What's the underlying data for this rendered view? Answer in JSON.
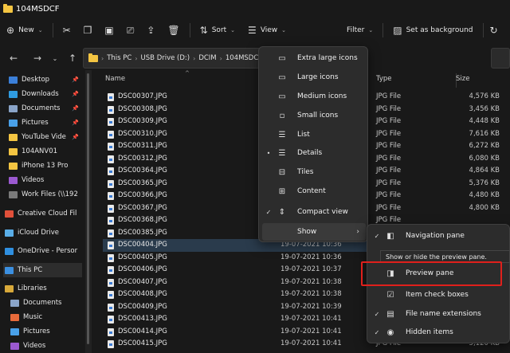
{
  "window": {
    "title": "104MSDCF"
  },
  "toolbar": {
    "new_label": "New",
    "sort_label": "Sort",
    "view_label": "View",
    "filter_label": "Filter",
    "background_label": "Set as background"
  },
  "address": {
    "crumbs": [
      "This PC",
      "USB Drive (D:)",
      "DCIM",
      "104MSDC"
    ]
  },
  "sidebar": {
    "items": [
      {
        "label": "Desktop",
        "color": "#3b7fd8",
        "pinned": true
      },
      {
        "label": "Downloads",
        "color": "#2f9be0",
        "pinned": true
      },
      {
        "label": "Documents",
        "color": "#8aa4c8",
        "pinned": true
      },
      {
        "label": "Pictures",
        "color": "#49a0e8",
        "pinned": true
      },
      {
        "label": "YouTube Vide",
        "color": "#f4c542",
        "pinned": true
      },
      {
        "label": "104ANV01",
        "color": "#f4c542",
        "pinned": false
      },
      {
        "label": "iPhone 13 Pro",
        "color": "#f4c542",
        "pinned": false
      },
      {
        "label": "Videos",
        "color": "#9b59d0",
        "pinned": false
      },
      {
        "label": "Work Files (\\\\192",
        "color": "#7a7a7a",
        "pinned": false
      },
      {
        "label": "Creative Cloud Fil",
        "color": "#e0503a",
        "pinned": false
      },
      {
        "label": "iCloud Drive",
        "color": "#5aaee8",
        "pinned": false
      },
      {
        "label": "OneDrive - Persor",
        "color": "#2f8fe0",
        "pinned": false
      },
      {
        "label": "This PC",
        "color": "#3b8fe0",
        "pinned": false
      },
      {
        "label": "Libraries",
        "color": "#d8a93a",
        "pinned": false
      },
      {
        "label": "Documents",
        "color": "#8aa4c8",
        "pinned": false
      },
      {
        "label": "Music",
        "color": "#e86a3a",
        "pinned": false
      },
      {
        "label": "Pictures",
        "color": "#49a0e8",
        "pinned": false
      },
      {
        "label": "Videos",
        "color": "#9b59d0",
        "pinned": false
      }
    ]
  },
  "columns": {
    "name": "Name",
    "type": "Type",
    "size": "Size"
  },
  "files": [
    {
      "name": "DSC00307.JPG",
      "date": "",
      "type": "JPG File",
      "size": "4,576 KB"
    },
    {
      "name": "DSC00308.JPG",
      "date": "",
      "type": "JPG File",
      "size": "3,456 KB"
    },
    {
      "name": "DSC00309.JPG",
      "date": "",
      "type": "JPG File",
      "size": "4,448 KB"
    },
    {
      "name": "DSC00310.JPG",
      "date": "",
      "type": "JPG File",
      "size": "7,616 KB"
    },
    {
      "name": "DSC00311.JPG",
      "date": "",
      "type": "JPG File",
      "size": "6,272 KB"
    },
    {
      "name": "DSC00312.JPG",
      "date": "",
      "type": "JPG File",
      "size": "6,080 KB"
    },
    {
      "name": "DSC00364.JPG",
      "date": "",
      "type": "JPG File",
      "size": "4,864 KB"
    },
    {
      "name": "DSC00365.JPG",
      "date": "",
      "type": "JPG File",
      "size": "5,376 KB"
    },
    {
      "name": "DSC00366.JPG",
      "date": "",
      "type": "JPG File",
      "size": "4,480 KB"
    },
    {
      "name": "DSC00367.JPG",
      "date": "",
      "type": "JPG File",
      "size": "4,800 KB"
    },
    {
      "name": "DSC00368.JPG",
      "date": "",
      "type": "JPG File",
      "size": ""
    },
    {
      "name": "DSC00385.JPG",
      "date": "",
      "type": "",
      "size": ""
    },
    {
      "name": "DSC00404.JPG",
      "date": "19-07-2021 10:36",
      "type": "",
      "size": ""
    },
    {
      "name": "DSC00405.JPG",
      "date": "19-07-2021 10:36",
      "type": "",
      "size": ""
    },
    {
      "name": "DSC00406.JPG",
      "date": "19-07-2021 10:37",
      "type": "",
      "size": ""
    },
    {
      "name": "DSC00407.JPG",
      "date": "19-07-2021 10:38",
      "type": "",
      "size": ""
    },
    {
      "name": "DSC00408.JPG",
      "date": "19-07-2021 10:38",
      "type": "",
      "size": ""
    },
    {
      "name": "DSC00409.JPG",
      "date": "19-07-2021 10:39",
      "type": "",
      "size": ""
    },
    {
      "name": "DSC00413.JPG",
      "date": "19-07-2021 10:41",
      "type": "",
      "size": ""
    },
    {
      "name": "DSC00414.JPG",
      "date": "19-07-2021 10:41",
      "type": "",
      "size": ""
    },
    {
      "name": "DSC00415.JPG",
      "date": "19-07-2021 10:41",
      "type": "JPG File",
      "size": "5,120 KB"
    }
  ],
  "view_menu": {
    "items": [
      {
        "label": "Extra large icons",
        "icon": "▭",
        "mark": ""
      },
      {
        "label": "Large icons",
        "icon": "▭",
        "mark": ""
      },
      {
        "label": "Medium icons",
        "icon": "▭",
        "mark": ""
      },
      {
        "label": "Small icons",
        "icon": "▫",
        "mark": ""
      },
      {
        "label": "List",
        "icon": "☰",
        "mark": ""
      },
      {
        "label": "Details",
        "icon": "☰",
        "mark": "•"
      },
      {
        "label": "Tiles",
        "icon": "⊟",
        "mark": ""
      },
      {
        "label": "Content",
        "icon": "⊞",
        "mark": ""
      },
      {
        "label": "Compact view",
        "icon": "⇕",
        "mark": "✓"
      },
      {
        "label": "Show",
        "icon": "",
        "mark": "",
        "arrow": "›"
      }
    ]
  },
  "show_menu": {
    "items": [
      {
        "label": "Navigation pane",
        "icon": "◧",
        "mark": "✓"
      },
      {
        "label": "Preview pane",
        "icon": "◨",
        "mark": ""
      },
      {
        "label": "Item check boxes",
        "icon": "☑",
        "mark": ""
      },
      {
        "label": "File name extensions",
        "icon": "▤",
        "mark": "✓"
      },
      {
        "label": "Hidden items",
        "icon": "◉",
        "mark": "✓"
      }
    ]
  },
  "tooltip": {
    "text": "Show or hide the preview pane."
  }
}
